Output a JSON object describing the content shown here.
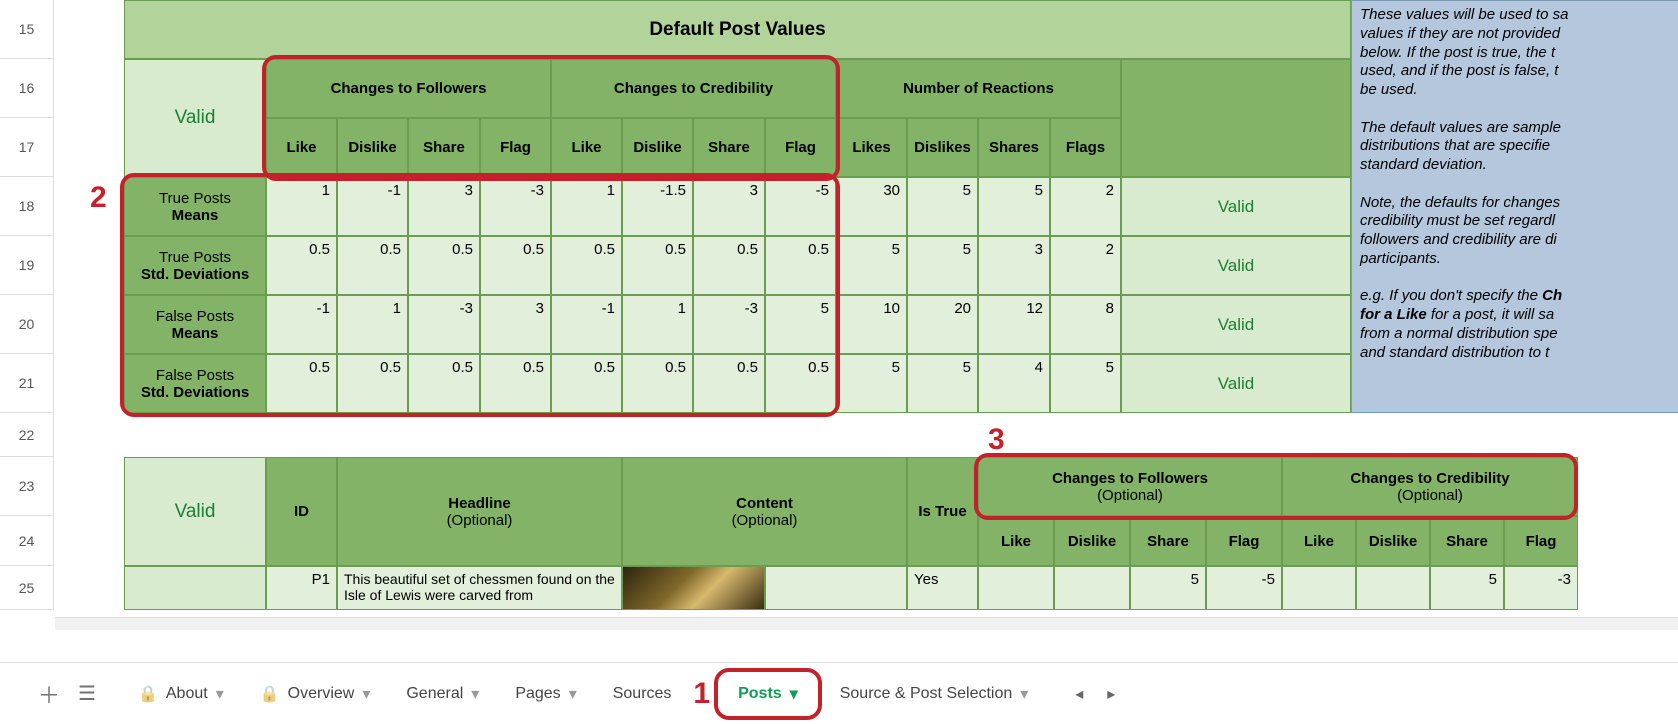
{
  "rows": [
    "15",
    "16",
    "17",
    "18",
    "19",
    "20",
    "21",
    "22",
    "23",
    "24",
    "25"
  ],
  "title": "Default Post Values",
  "valid": "Valid",
  "col_groups": {
    "followers": "Changes to Followers",
    "credibility": "Changes to Credibility",
    "reactions": "Number of Reactions"
  },
  "sub_cols": {
    "like": "Like",
    "dislike": "Dislike",
    "share": "Share",
    "flag": "Flag",
    "likes": "Likes",
    "dislikes": "Dislikes",
    "shares": "Shares",
    "flags": "Flags"
  },
  "row_labels": {
    "tpm_a": "True Posts",
    "tpm_b": "Means",
    "tps_a": "True Posts",
    "tps_b": "Std. Deviations",
    "fpm_a": "False Posts",
    "fpm_b": "Means",
    "fps_a": "False Posts",
    "fps_b": "Std. Deviations"
  },
  "data": {
    "tpm": {
      "f_like": "1",
      "f_dislike": "-1",
      "f_share": "3",
      "f_flag": "-3",
      "c_like": "1",
      "c_dislike": "-1.5",
      "c_share": "3",
      "c_flag": "-5",
      "r_likes": "30",
      "r_dislikes": "5",
      "r_shares": "5",
      "r_flags": "2"
    },
    "tps": {
      "f_like": "0.5",
      "f_dislike": "0.5",
      "f_share": "0.5",
      "f_flag": "0.5",
      "c_like": "0.5",
      "c_dislike": "0.5",
      "c_share": "0.5",
      "c_flag": "0.5",
      "r_likes": "5",
      "r_dislikes": "5",
      "r_shares": "3",
      "r_flags": "2"
    },
    "fpm": {
      "f_like": "-1",
      "f_dislike": "1",
      "f_share": "-3",
      "f_flag": "3",
      "c_like": "-1",
      "c_dislike": "1",
      "c_share": "-3",
      "c_flag": "5",
      "r_likes": "10",
      "r_dislikes": "20",
      "r_shares": "12",
      "r_flags": "8"
    },
    "fps": {
      "f_like": "0.5",
      "f_dislike": "0.5",
      "f_share": "0.5",
      "f_flag": "0.5",
      "c_like": "0.5",
      "c_dislike": "0.5",
      "c_share": "0.5",
      "c_flag": "0.5",
      "r_likes": "5",
      "r_dislikes": "5",
      "r_shares": "4",
      "r_flags": "5"
    }
  },
  "note1": "These values will be used to sa",
  "note2": "values if they are not provided",
  "note3": "below. If the post is true, the t",
  "note4": "used, and if the post is false, t",
  "note5": "be used.",
  "note6": "The default values are sample",
  "note7": "distributions that are specifie",
  "note8": "standard deviation.",
  "note9": "Note, the defaults for changes",
  "note10": "credibility must be set regardl",
  "note11": "followers and credibility are di",
  "note12": "participants.",
  "note13": "e.g. If you don't specify the ",
  "note13b": "Ch",
  "note14": "for a Like",
  "note14b": "  for a post, it will sa",
  "note15": "from a normal distribution spe",
  "note16": "and standard distribution to t",
  "table2": {
    "valid": "Valid",
    "id": "ID",
    "headline": "Headline",
    "headline_opt": "(Optional)",
    "content": "Content",
    "content_opt": "(Optional)",
    "istrue": "Is True",
    "ctf": "Changes to Followers",
    "ctf_opt": "(Optional)",
    "ctc": "Changes to Credibility",
    "ctc_opt": "(Optional)",
    "like": "Like",
    "dislike": "Dislike",
    "share": "Share",
    "flag": "Flag"
  },
  "row25": {
    "id": "P1",
    "headline": "This beautiful set of chessmen found on the Isle of Lewis were carved from",
    "istrue": "Yes",
    "f_share": "5",
    "f_flag": "-5",
    "c_share": "5",
    "c_flag": "-3"
  },
  "anno": {
    "n1": "1",
    "n2": "2",
    "n3": "3"
  },
  "tabs": {
    "about": "About",
    "overview": "Overview",
    "general": "General",
    "pages": "Pages",
    "sources": "Sources",
    "posts": "Posts",
    "sps": "Source & Post Selection"
  }
}
